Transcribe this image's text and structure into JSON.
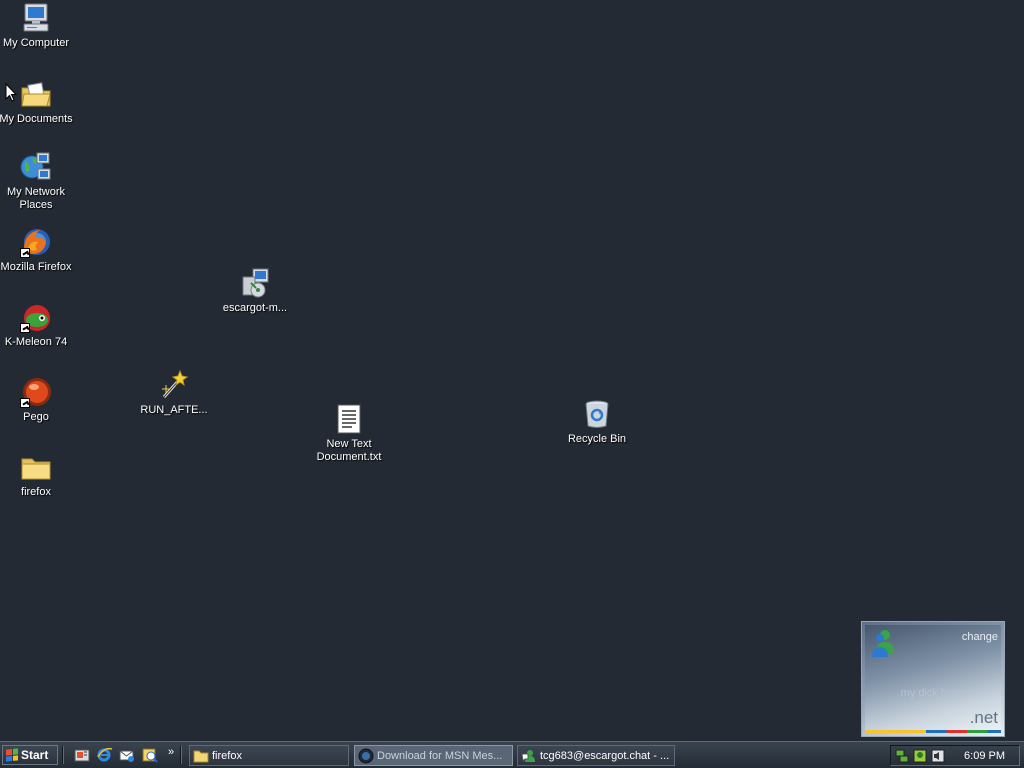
{
  "desktop": {
    "icons": [
      {
        "label": "My Computer",
        "icon": "computer-icon"
      },
      {
        "label": "My Documents",
        "icon": "documents-folder-icon"
      },
      {
        "label": "My Network\nPlaces",
        "icon": "network-icon"
      },
      {
        "label": "Mozilla Firefox",
        "icon": "firefox-icon",
        "shortcut": true
      },
      {
        "label": "K-Meleon 74",
        "icon": "k-meleon-icon",
        "shortcut": true
      },
      {
        "label": "Pego",
        "icon": "pego-icon",
        "shortcut": true
      },
      {
        "label": "firefox",
        "icon": "folder-icon"
      },
      {
        "label": "escargot-m...",
        "icon": "installer-icon"
      },
      {
        "label": "RUN_AFTE...",
        "icon": "wand-icon"
      },
      {
        "label": "New Text\nDocument.txt",
        "icon": "text-document-icon"
      },
      {
        "label": "Recycle Bin",
        "icon": "recycle-bin-icon"
      }
    ]
  },
  "msn_alert": {
    "change_link": "change",
    "message": "my dick hurts",
    "brand": ".net",
    "accent_colors": [
      "#f7c52b",
      "#1f70b8",
      "#d8342b",
      "#2d9e3f"
    ]
  },
  "taskbar": {
    "start_label": "Start",
    "quick_launch": [
      "show-desktop-icon",
      "internet-explorer-icon",
      "outlook-express-icon",
      "windows-media-icon"
    ],
    "overflow_label": "»",
    "tasks": [
      {
        "label": "firefox",
        "icon": "folder-icon",
        "active": false
      },
      {
        "label": "Download for MSN Mes...",
        "icon": "browser-icon",
        "active": true
      },
      {
        "label": "tcg683@escargot.chat - ...",
        "icon": "msn-chat-icon",
        "active": false
      }
    ],
    "tray_icons": [
      "network-tray-icon",
      "msn-tray-icon",
      "volume-tray-icon"
    ],
    "clock": "6:09 PM"
  }
}
